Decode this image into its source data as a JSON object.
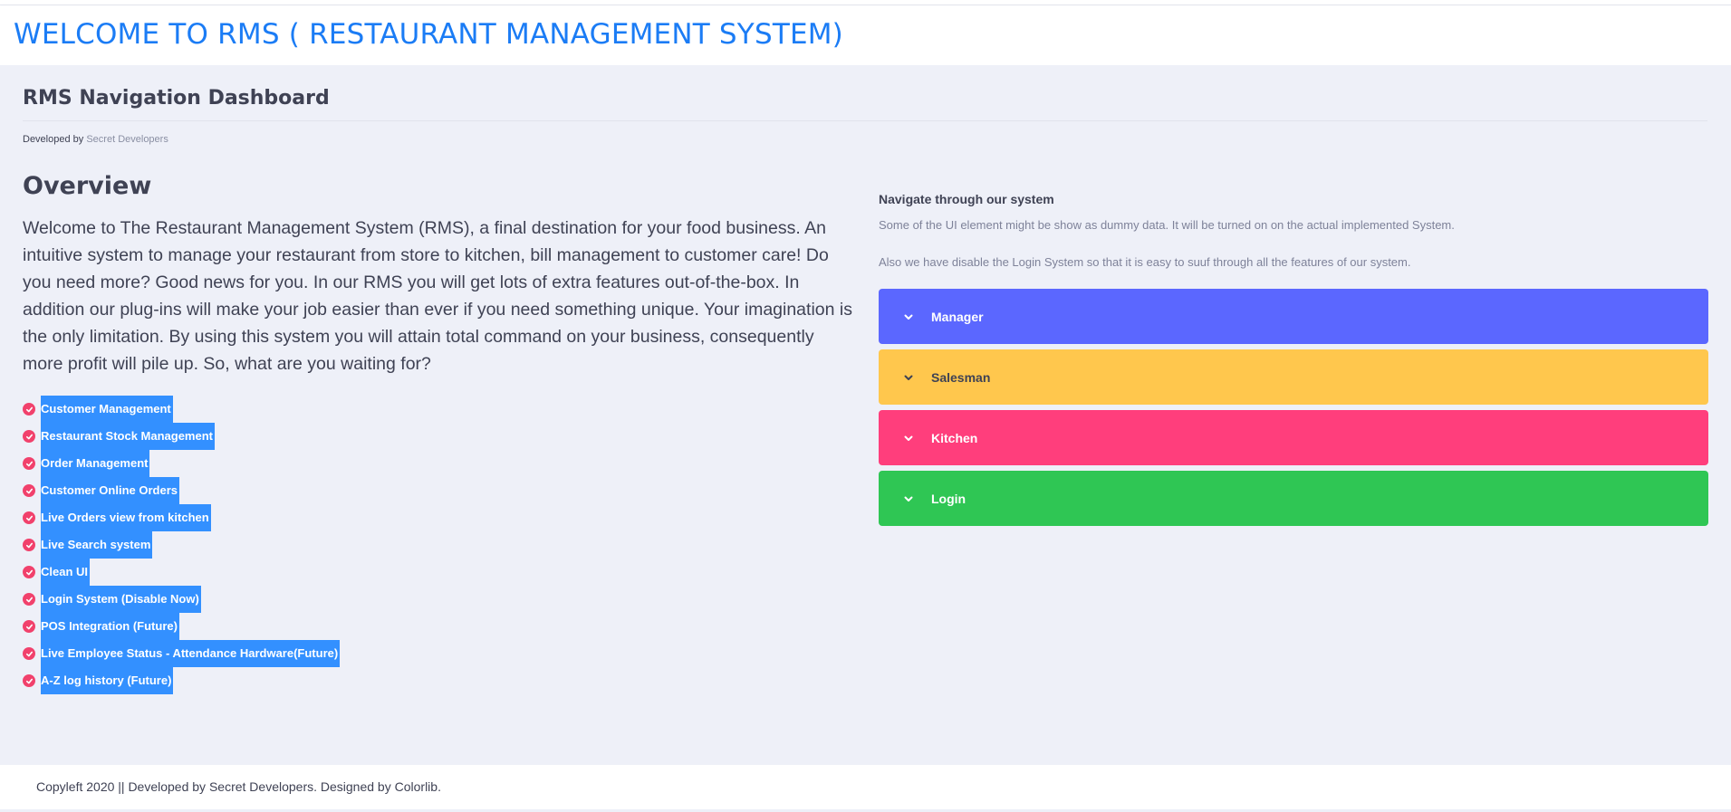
{
  "header": {
    "title": "WELCOME TO RMS ( RESTAURANT MANAGEMENT SYSTEM)"
  },
  "page": {
    "title": "RMS Navigation Dashboard",
    "developed_by_label": "Developed by",
    "developer_link": "Secret Developers"
  },
  "overview": {
    "title": "Overview",
    "text": "Welcome to The Restaurant Management System (RMS), a final destination for your food business. An intuitive system to manage your restaurant from store to kitchen, bill management to customer care! Do you need more? Good news for you. In our RMS you will get lots of extra features out-of-the-box. In addition our plug-ins will make your job easier than ever if you need something unique. Your imagination is the only limitation. By using this system you will attain total command on your business, consequently more profit will pile up. So, what are you waiting for?",
    "features": [
      "Customer Management",
      "Restaurant Stock Management",
      "Order Management",
      "Customer Online Orders",
      "Live Orders view from kitchen",
      "Live Search system",
      "Clean UI",
      "Login System (Disable Now)",
      "POS Integration (Future)",
      "Live Employee Status - Attendance Hardware(Future)",
      "A-Z log history (Future)"
    ]
  },
  "nav": {
    "heading": "Navigate through our system",
    "desc1": "Some of the UI element might be show as dummy data. It will be turned on on the actual implemented System.",
    "desc2": "Also we have disable the Login System so that it is easy to suuf through all the features of our system.",
    "panels": [
      {
        "label": "Manager",
        "color": "#5b67ff",
        "text_color": "#ffffff",
        "icon": "chevron-down-icon"
      },
      {
        "label": "Salesman",
        "color": "#ffc74d",
        "text_color": "#3f4254",
        "icon": "chevron-down-icon"
      },
      {
        "label": "Kitchen",
        "color": "#ff3e7c",
        "text_color": "#ffffff",
        "icon": "chevron-down-icon"
      },
      {
        "label": "Login",
        "color": "#2fc654",
        "text_color": "#ffffff",
        "icon": "chevron-down-icon"
      }
    ]
  },
  "footer": {
    "text": "Copyleft 2020 || Developed by Secret Developers. Designed by Colorlib."
  },
  "colors": {
    "accent": "#1b7cf5",
    "selection": "#3390ff",
    "check": "#f1416c",
    "background": "#eef0f8"
  }
}
